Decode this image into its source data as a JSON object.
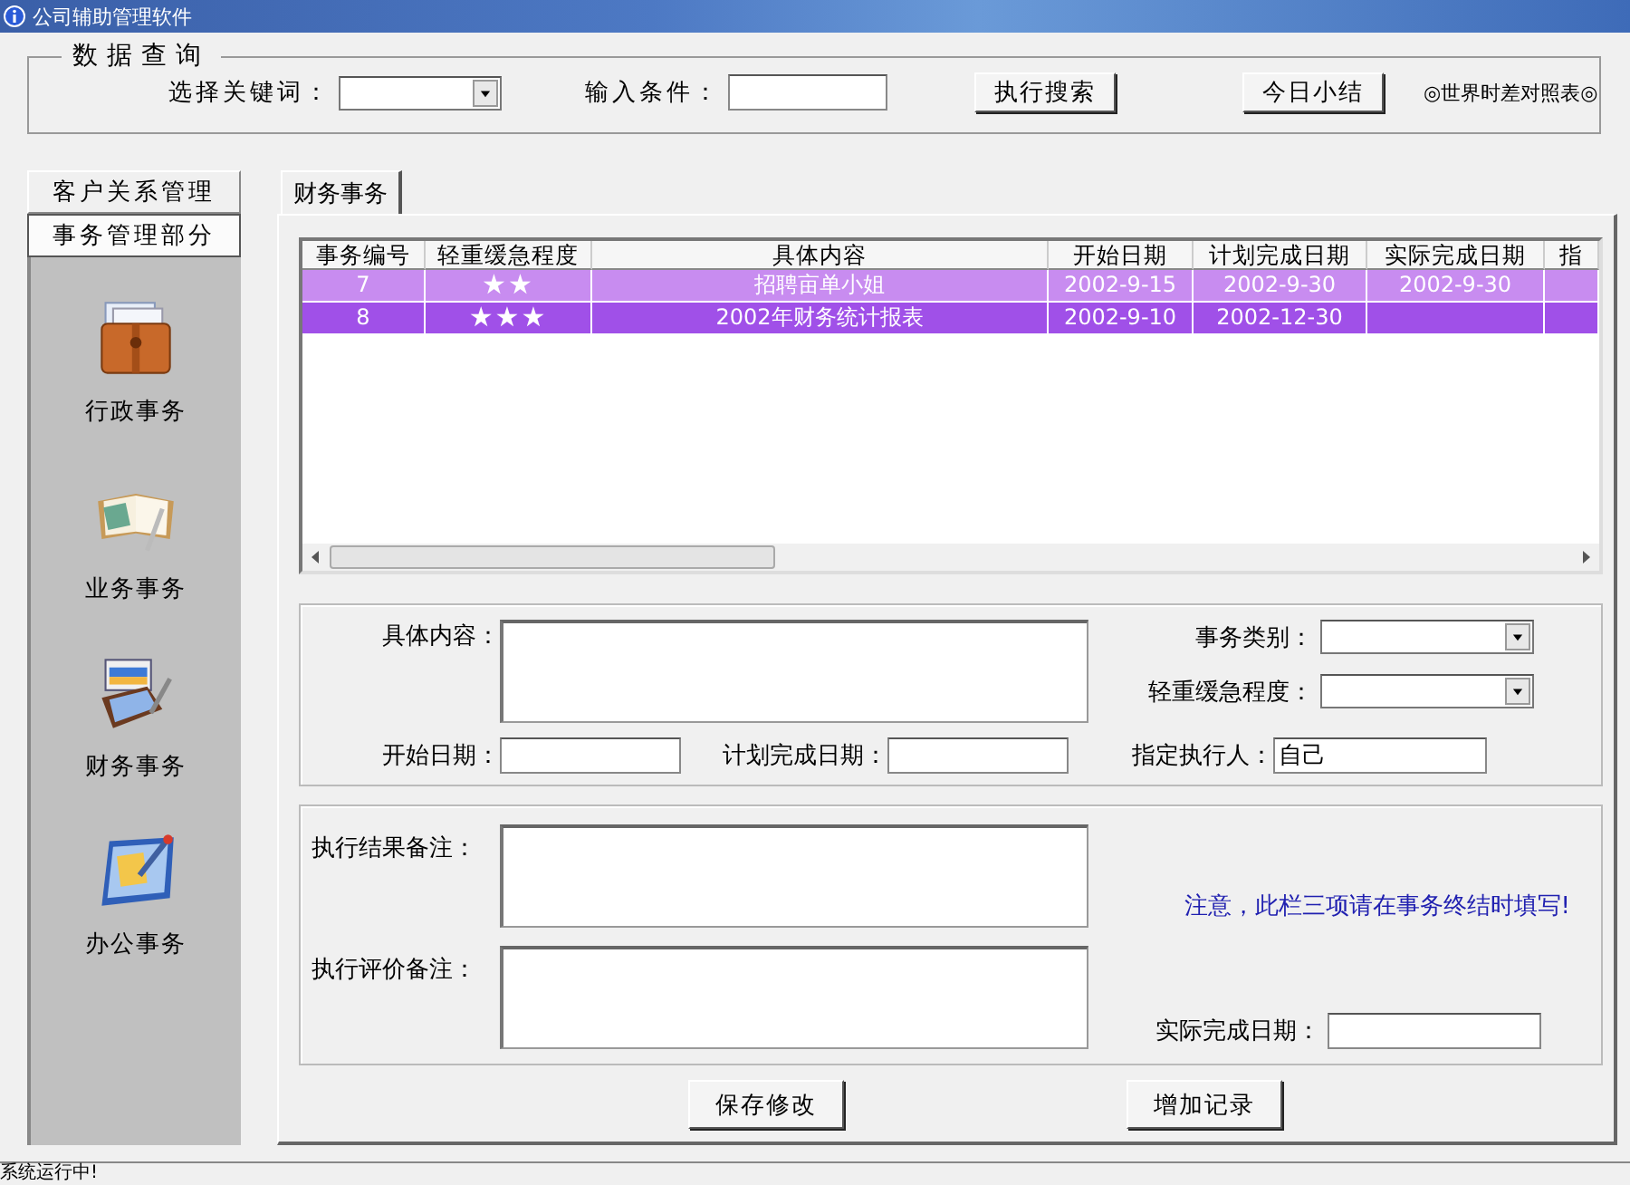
{
  "window": {
    "title": "公司辅助管理软件"
  },
  "search": {
    "legend": "数据查询",
    "keyword_label": "选择关键词：",
    "condition_label": "输入条件：",
    "search_button": "执行搜索",
    "summary_button": "今日小结",
    "world_time_link": "◎世界时差对照表◎"
  },
  "sidebar": {
    "sections": [
      {
        "label": "客户关系管理",
        "selected": false
      },
      {
        "label": "事务管理部分",
        "selected": true
      }
    ],
    "items": [
      {
        "label": "行政事务",
        "kind": "folder"
      },
      {
        "label": "业务事务",
        "kind": "book"
      },
      {
        "label": "财务事务",
        "kind": "wallet"
      },
      {
        "label": "办公事务",
        "kind": "memo"
      }
    ]
  },
  "tabs": [
    {
      "label": "财务事务",
      "selected": true
    }
  ],
  "table": {
    "columns": [
      "事务编号",
      "轻重缓急程度",
      "具体内容",
      "开始日期",
      "计划完成日期",
      "实际完成日期",
      "指"
    ],
    "rows": [
      {
        "id": "7",
        "priority": "★★",
        "content": "招聘亩单小姐",
        "start": "2002-9-15",
        "planned": "2002-9-30",
        "actual": "2002-9-30",
        "selected": false
      },
      {
        "id": "8",
        "priority": "★★★",
        "content": "2002年财务统计报表",
        "start": "2002-9-10",
        "planned": "2002-12-30",
        "actual": "",
        "selected": true
      }
    ]
  },
  "details_form": {
    "content_label": "具体内容：",
    "category_label": "事务类别：",
    "priority_label": "轻重缓急程度：",
    "start_label": "开始日期：",
    "planned_label": "计划完成日期：",
    "executor_label": "指定执行人：",
    "executor_value": "自己"
  },
  "completion_form": {
    "result_label": "执行结果备注：",
    "evaluation_label": "执行评价备注：",
    "notice": "注意，此栏三项请在事务终结时填写!",
    "actual_label": "实际完成日期："
  },
  "buttons": [
    "保存修改",
    "增加记录"
  ],
  "status_bar": "系统运行中!"
}
